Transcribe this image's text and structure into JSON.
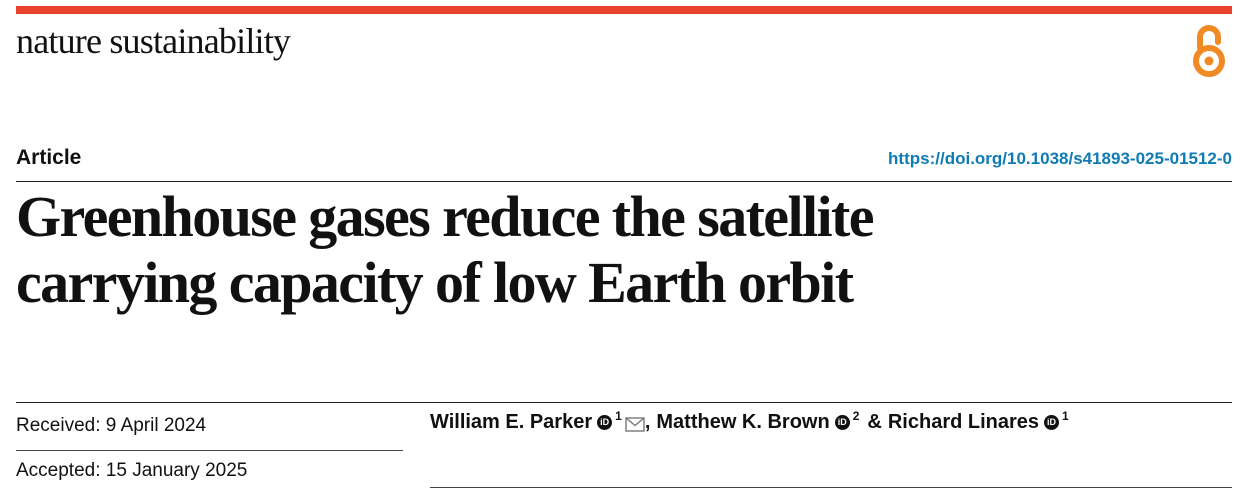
{
  "journal": {
    "name": "nature sustainability",
    "accent_color": "#e8412c",
    "open_access_icon": "open-access-icon"
  },
  "article": {
    "type": "Article",
    "doi": "https://doi.org/10.1038/s41893-025-01512-0",
    "title_line1": "Greenhouse gases reduce the satellite",
    "title_line2": "carrying capacity of low Earth orbit"
  },
  "dates": {
    "received": "Received: 9 April 2024",
    "accepted": "Accepted: 15 January 2025"
  },
  "authors": [
    {
      "name": "William E. Parker",
      "affiliation": "1",
      "corresponding": true
    },
    {
      "name": "Matthew K. Brown",
      "affiliation": "2"
    },
    {
      "name": "Richard Linares",
      "affiliation": "1"
    }
  ],
  "author_separators": {
    "first": ",",
    "second": "&"
  },
  "icons": {
    "orcid": "orcid-icon",
    "mail": "mail-icon"
  }
}
